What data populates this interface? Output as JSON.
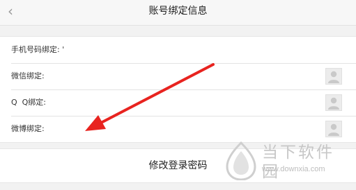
{
  "header": {
    "title": "账号绑定信息",
    "back_icon": "chevron-left-icon"
  },
  "bindings": [
    {
      "label": "手机号码绑定: '",
      "avatar_icon": ""
    },
    {
      "label": "微信绑定:",
      "avatar_icon": "user-avatar-icon"
    },
    {
      "label": "Q  Q绑定:",
      "avatar_icon": "user-avatar-icon"
    },
    {
      "label": "微博绑定:",
      "avatar_icon": "user-avatar-icon"
    }
  ],
  "change_password": "修改登录密码",
  "watermark": {
    "brand": "当下软件园",
    "url": "www.downxia.com"
  },
  "colors": {
    "annotation_arrow": "#e8231f"
  }
}
